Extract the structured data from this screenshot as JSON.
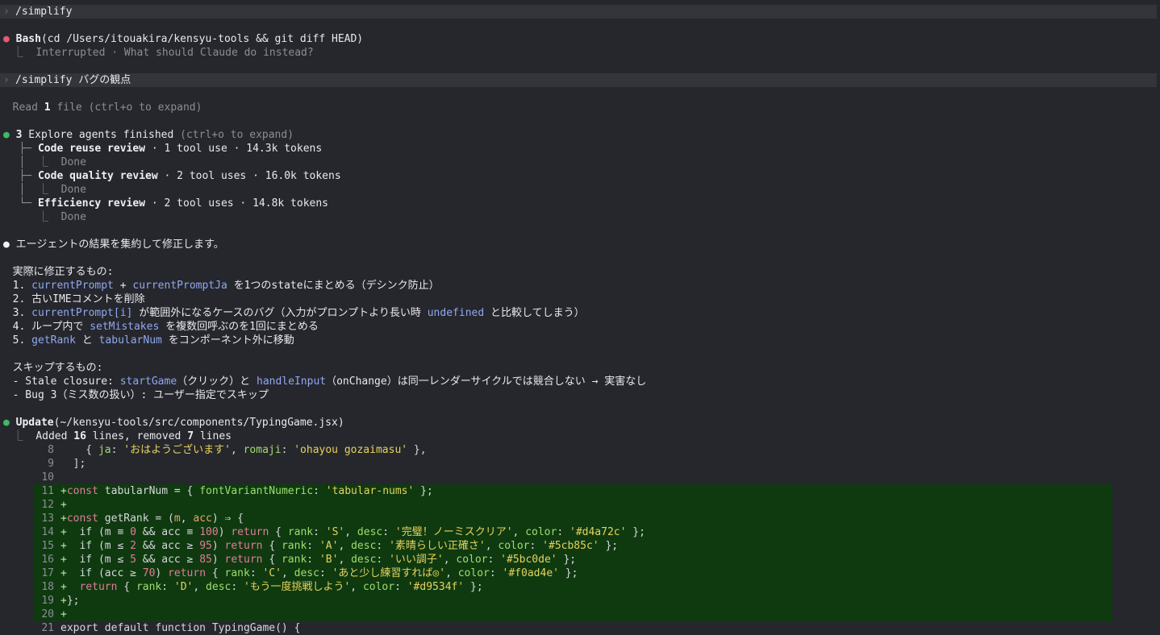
{
  "prompts": [
    "/simplify",
    "/simplify バグの観点"
  ],
  "bash": {
    "tool": "Bash",
    "command": "(cd /Users/itouakira/kensyu-tools && git diff HEAD)",
    "result": "Interrupted · What should Claude do instead?"
  },
  "read": {
    "pre": "Read ",
    "count": "1",
    "post": " file (ctrl+o to expand)"
  },
  "agents": {
    "count": "3",
    "label": " Explore agents finished ",
    "hint": "(ctrl+o to expand)",
    "items": [
      {
        "name": "Code reuse review",
        "meta": " · 1 tool use · 14.3k tokens",
        "status": "Done"
      },
      {
        "name": "Code quality review",
        "meta": " · 2 tool uses · 16.0k tokens",
        "status": "Done"
      },
      {
        "name": "Efficiency review",
        "meta": " · 2 tool uses · 14.8k tokens",
        "status": "Done"
      }
    ]
  },
  "message": {
    "intro": "エージェントの結果を集約して修正します。",
    "fix_header": "実際に修正するもの:",
    "fixes": [
      {
        "n": "1. ",
        "c1": "currentPrompt",
        "t1": " + ",
        "c2": "currentPromptJa",
        "t2": " を1つのstateにまとめる（デシンク防止）"
      },
      {
        "n": "2. ",
        "t1": "古いIMEコメントを削除"
      },
      {
        "n": "3. ",
        "c1": "currentPrompt[i]",
        "t1": " が範囲外になるケースのバグ（入力がプロンプトより長い時 ",
        "c2": "undefined",
        "t2": " と比較してしまう）"
      },
      {
        "n": "4. ",
        "t1": "ループ内で ",
        "c1": "setMistakes",
        "t2": " を複数回呼ぶのを1回にまとめる"
      },
      {
        "n": "5. ",
        "c1": "getRank",
        "t1": " と ",
        "c2": "tabularNum",
        "t2": " をコンポーネント外に移動"
      }
    ],
    "skip_header": "スキップするもの:",
    "skip1": {
      "a": "- Stale closure: ",
      "c1": "startGame",
      "b": "（クリック）と ",
      "c2": "handleInput",
      "c": "（onChange）は同一レンダーサイクルでは競合しない → 実害なし"
    },
    "skip2": "- Bug 3（ミス数の扱い）: ユーザー指定でスキップ"
  },
  "update": {
    "tool": "Update",
    "path": "(~/kensyu-tools/src/components/TypingGame.jsx)",
    "summary_pre": "Added ",
    "added": "16",
    "summary_mid": " lines, removed ",
    "removed": "7",
    "summary_post": " lines"
  },
  "code": {
    "l8": {
      "num": "8",
      "a": "    { ",
      "k1": "ja",
      "b": ": ",
      "s1": "'おはようございます'",
      "c": ", ",
      "k2": "romaji",
      "d": ": ",
      "s2": "'ohayou gozaimasu'",
      "e": " },"
    },
    "l9": {
      "num": "9",
      "a": "  ];"
    },
    "l10": {
      "num": "10"
    },
    "l11": {
      "num": "11",
      "plus": "+",
      "kw": "const",
      "a": " tabularNum = { ",
      "p": "fontVariantNumeric",
      "b": ": ",
      "s": "'tabular-nums'",
      "c": " };"
    },
    "l12": {
      "num": "12",
      "plus": "+"
    },
    "l13": {
      "num": "13",
      "plus": "+",
      "kw": "const",
      "a": " getRank = (",
      "p1": "m",
      "b": ", ",
      "p2": "acc",
      "c": ") ⇒ {"
    },
    "rank_lines": [
      {
        "num": "14",
        "cond_a": "  if (m ≡ ",
        "n1": "0",
        "cond_b": " && acc ≡ ",
        "n2": "100",
        "rank": "'S'",
        "desc": "'完璧！ノーミスクリア'",
        "color": "'#d4a72c'"
      },
      {
        "num": "15",
        "cond_a": "  if (m ≤ ",
        "n1": "2",
        "cond_b": " && acc ≥ ",
        "n2": "95",
        "rank": "'A'",
        "desc": "'素晴らしい正確さ'",
        "color": "'#5cb85c'"
      },
      {
        "num": "16",
        "cond_a": "  if (m ≤ ",
        "n1": "5",
        "cond_b": " && acc ≥ ",
        "n2": "85",
        "rank": "'B'",
        "desc": "'いい調子'",
        "color": "'#5bc0de'"
      },
      {
        "num": "17",
        "cond_a": "  if (acc ≥ ",
        "n1": "70",
        "cond_b": "",
        "n2": "",
        "rank": "'C'",
        "desc": "'あと少し練習すれば◎'",
        "color": "'#f0ad4e'"
      }
    ],
    "l18": {
      "num": "18",
      "rank": "'D'",
      "desc": "'もう一度挑戦しよう'",
      "color": "'#d9534f'"
    },
    "l19": {
      "num": "19",
      "a": "};"
    },
    "l20": {
      "num": "20"
    },
    "l21": {
      "num": "21",
      "a": "export default function TypingGame() {"
    }
  },
  "tokens": {
    "ret": "return",
    "rank_k": "rank",
    "desc_k": "desc",
    "color_k": "color",
    "plus": "+"
  }
}
